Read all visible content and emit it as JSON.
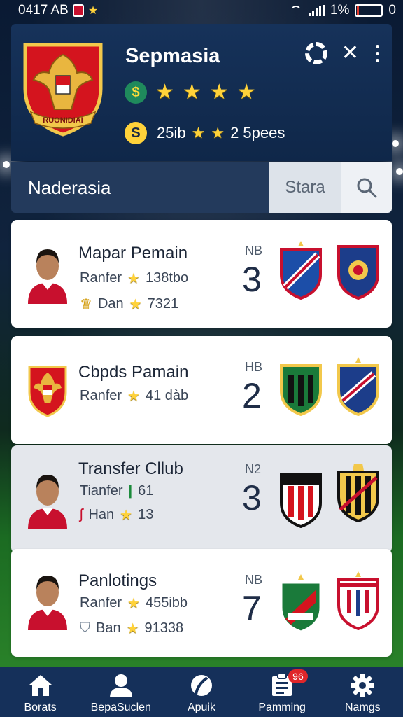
{
  "status_bar": {
    "time": "0417 AB",
    "battery": "1%",
    "battery_suffix": "0"
  },
  "header": {
    "crest_text": "RUONIDIAI",
    "team_name": "Sepmasia",
    "meta_value": "25ib",
    "meta_count": "2 5pees",
    "green_coin_symbol": "$",
    "gold_coin_symbol": "S",
    "stars": 4
  },
  "search": {
    "label": "Naderasia",
    "field_text": "Stara"
  },
  "cards": [
    {
      "title": "Mapar Pemain",
      "line1_label": "Ranfer",
      "line1_value": "138tbo",
      "line2_label": "Dan",
      "line2_value": "7321",
      "rank_code": "NB",
      "rank_num": "3",
      "alt": false
    },
    {
      "title": "Cbpds Pamain",
      "line1_label": "Ranfer",
      "line1_value": "41 dàb",
      "rank_code": "HB",
      "rank_num": "2",
      "alt": false
    },
    {
      "title": "Transfer Cllub",
      "line1_label": "Tianfer",
      "line1_value": "61",
      "line2_label": "Han",
      "line2_value": "13",
      "rank_code": "N2",
      "rank_num": "3",
      "alt": true
    },
    {
      "title": "Panlotings",
      "line1_label": "Ranfer",
      "line1_value": "455ibb",
      "line2_label": "Ban",
      "line2_value": "91338",
      "rank_code": "NB",
      "rank_num": "7",
      "alt": false
    }
  ],
  "nav": [
    {
      "label": "Borats",
      "icon": "home-icon"
    },
    {
      "label": "BepaSuclen",
      "icon": "person-icon"
    },
    {
      "label": "Apuik",
      "icon": "ball-icon"
    },
    {
      "label": "Pamming",
      "icon": "clipboard-icon",
      "badge": "96"
    },
    {
      "label": "Namgs",
      "icon": "gear-icon"
    }
  ],
  "colors": {
    "accent_gold": "#ffd23a",
    "header_bg": "#16325a",
    "nav_bg": "#15305a",
    "badge_red": "#e0262a"
  }
}
